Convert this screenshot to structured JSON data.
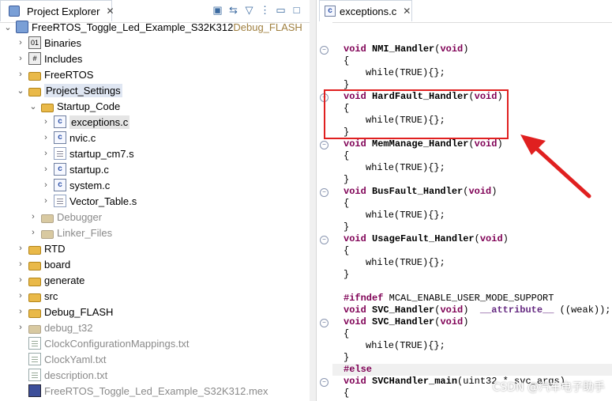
{
  "explorer": {
    "tab_label": "Project Explorer",
    "close": "✕",
    "project": {
      "name": "FreeRTOS_Toggle_Led_Example_S32K312",
      "config": " Debug_FLASH"
    },
    "items": [
      {
        "label": "Binaries",
        "arrow": "›",
        "icon": "binaries-icon"
      },
      {
        "label": "Includes",
        "arrow": "›",
        "icon": "includes-icon"
      },
      {
        "label": "FreeRTOS",
        "arrow": "›",
        "icon": "folder-icon"
      },
      {
        "label": "Project_Settings",
        "arrow": "⌄",
        "icon": "folder-icon"
      },
      {
        "label": "Startup_Code",
        "arrow": "⌄",
        "icon": "folder-icon"
      },
      {
        "label": "exceptions.c",
        "arrow": "›",
        "icon": "c-file-icon"
      },
      {
        "label": "nvic.c",
        "arrow": "›",
        "icon": "c-file-icon"
      },
      {
        "label": "startup_cm7.s",
        "arrow": "›",
        "icon": "s-file-icon"
      },
      {
        "label": "startup.c",
        "arrow": "›",
        "icon": "c-file-icon"
      },
      {
        "label": "system.c",
        "arrow": "›",
        "icon": "c-file-icon"
      },
      {
        "label": "Vector_Table.s",
        "arrow": "›",
        "icon": "s-file-icon"
      },
      {
        "label": "Debugger",
        "arrow": "›",
        "icon": "folder-icon"
      },
      {
        "label": "Linker_Files",
        "arrow": "›",
        "icon": "folder-icon"
      },
      {
        "label": "RTD",
        "arrow": "›",
        "icon": "folder-icon"
      },
      {
        "label": "board",
        "arrow": "›",
        "icon": "folder-icon"
      },
      {
        "label": "generate",
        "arrow": "›",
        "icon": "folder-icon"
      },
      {
        "label": "src",
        "arrow": "›",
        "icon": "folder-icon"
      },
      {
        "label": "Debug_FLASH",
        "arrow": "›",
        "icon": "folder-icon"
      },
      {
        "label": "debug_t32",
        "arrow": "›",
        "icon": "folder-icon"
      },
      {
        "label": "ClockConfigurationMappings.txt",
        "arrow": "",
        "icon": "txt-file-icon"
      },
      {
        "label": "ClockYaml.txt",
        "arrow": "",
        "icon": "txt-file-icon"
      },
      {
        "label": "description.txt",
        "arrow": "",
        "icon": "txt-file-icon"
      },
      {
        "label": "FreeRTOS_Toggle_Led_Example_S32K312.mex",
        "arrow": "",
        "icon": "mex-file-icon"
      }
    ]
  },
  "editor": {
    "tab_label": "exceptions.c",
    "close": "✕",
    "code": {
      "nmi": "NMI_Handler",
      "hardfault": "HardFault_Handler",
      "memmanage": "MemManage_Handler",
      "busfault": "BusFault_Handler",
      "usagefault": "UsageFault_Handler",
      "svc": "SVC_Handler",
      "svc_main": "SVCHandler_main",
      "kw_void": "void",
      "body": "while(TRUE){};",
      "ifndef": "#ifndef",
      "macro": " MCAL_ENABLE_USER_MODE_SUPPORT",
      "attr": "__attribute__",
      "weak": " ((weak));",
      "else": "#else",
      "svc_main_args": "(uint32 * svc_args)"
    }
  },
  "watermark": "CSDN @汽车电子助手"
}
